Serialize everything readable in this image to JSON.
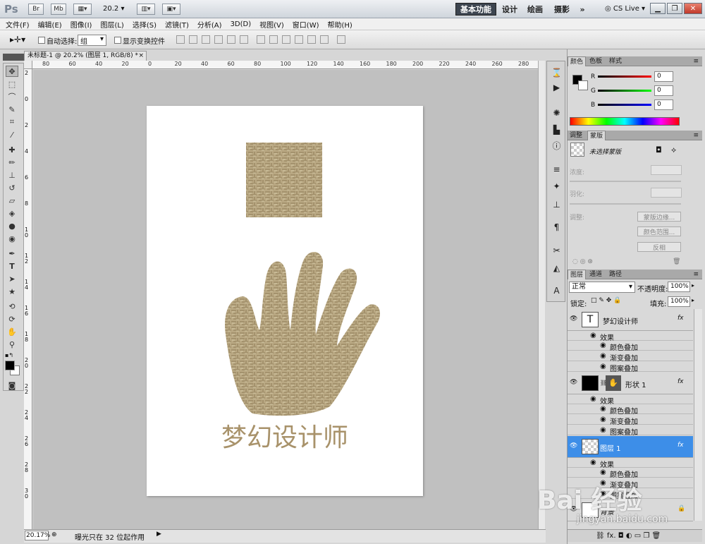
{
  "app": {
    "logo": "Ps",
    "bridge_label": "Br",
    "minibridge_label": "Mb",
    "zoom": "20.2",
    "workspaces": [
      "基本功能",
      "设计",
      "绘画",
      "摄影"
    ],
    "more_label": "»",
    "cs_live": "CS Live"
  },
  "menu": [
    "文件(F)",
    "编辑(E)",
    "图像(I)",
    "图层(L)",
    "选择(S)",
    "滤镜(T)",
    "分析(A)",
    "3D(D)",
    "视图(V)",
    "窗口(W)",
    "帮助(H)"
  ],
  "options": {
    "auto_select_label": "自动选择:",
    "auto_select_value": "组",
    "show_transform_label": "显示变换控件"
  },
  "document": {
    "tab_title": "未标题-1 @ 20.2% (图层 1, RGB/8) *",
    "close": "×",
    "ruler_h": [
      "80",
      "60",
      "40",
      "20",
      "0",
      "20",
      "40",
      "60",
      "80",
      "100",
      "120",
      "140",
      "160",
      "180",
      "200",
      "220",
      "240",
      "260",
      "280"
    ],
    "ruler_v": [
      "2",
      "0",
      "2",
      "4",
      "6",
      "8",
      "1 0",
      "1 2",
      "1 4",
      "1 6",
      "1 8",
      "2 0",
      "2 2",
      "2 4",
      "2 6",
      "2 8",
      "3 0"
    ],
    "artwork_text": "梦幻设计师"
  },
  "status": {
    "zoom": "20.17%",
    "message": "曝光只在 32 位起作用"
  },
  "color_panel": {
    "tabs": [
      "颜色",
      "色板",
      "样式"
    ],
    "channels": [
      {
        "label": "R",
        "value": "0",
        "color": "#cc0000"
      },
      {
        "label": "G",
        "value": "0",
        "color": "#00aa00"
      },
      {
        "label": "B",
        "value": "0",
        "color": "#0000cc"
      }
    ]
  },
  "masks_panel": {
    "tabs": [
      "调整",
      "蒙版"
    ],
    "no_mask": "未选择蒙版",
    "density": "浓度:",
    "feather": "羽化:",
    "refine": "调整:",
    "buttons": [
      "蒙版边缘...",
      "颜色范围...",
      "反相"
    ]
  },
  "layers_panel": {
    "tabs": [
      "图层",
      "通道",
      "路径"
    ],
    "blend_mode": "正常",
    "opacity_label": "不透明度:",
    "opacity": "100%",
    "lock_label": "锁定:",
    "fill_label": "填充:",
    "fill": "100%",
    "fx": "fx",
    "effects_label": "效果",
    "layers": [
      {
        "name": "梦幻设计师",
        "thumb": "T",
        "effects": [
          "颜色叠加",
          "渐变叠加",
          "图案叠加"
        ]
      },
      {
        "name": "形状 1",
        "thumb": "",
        "effects": [
          "颜色叠加",
          "渐变叠加",
          "图案叠加"
        ]
      },
      {
        "name": "图层 1",
        "thumb": "",
        "effects": [
          "颜色叠加",
          "渐变叠加",
          "图案叠加"
        ]
      },
      {
        "name": "背景",
        "thumb": ""
      }
    ]
  },
  "colors": {
    "selected_layer": "#3d8ee8",
    "gold": "#b5a27a",
    "workspace": "#c0c0c0"
  },
  "watermark": {
    "text": "Bai 经验",
    "url": "jingyan.baidu.com"
  }
}
